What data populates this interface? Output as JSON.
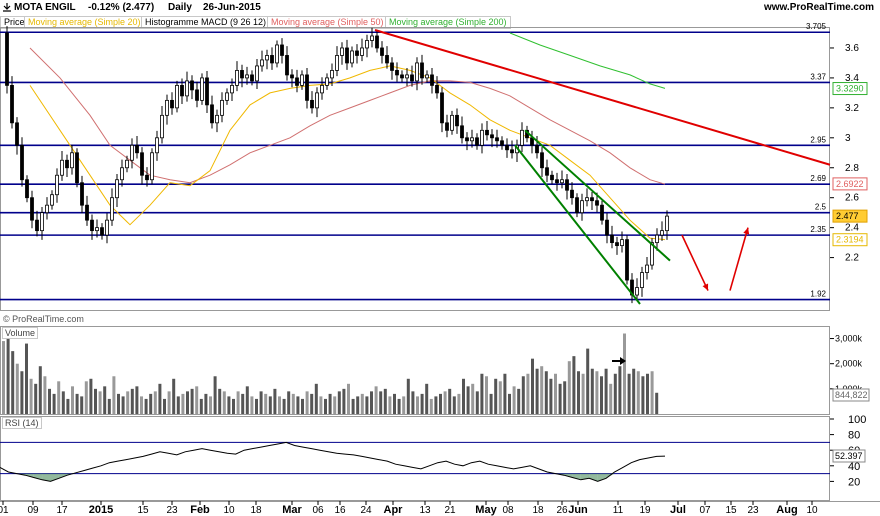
{
  "header": {
    "symbol": "MOTA ENGIL",
    "change_text": "-0.12% (2.477)",
    "period": "Daily",
    "date": "26-Jun-2015",
    "site": "www.ProRealTime.com"
  },
  "indicator_tabs": [
    {
      "label": "Price",
      "color": "#000000"
    },
    {
      "label": "Moving average (Simple 20)",
      "color": "#e6b800"
    },
    {
      "label": "Histogramme MACD (9 26 12)",
      "color": "#000000"
    },
    {
      "label": "Moving average (Simple 50)",
      "color": "#e06060"
    },
    {
      "label": "Moving average (Simple 200)",
      "color": "#30b030"
    }
  ],
  "watermark": "© ProRealTime.com",
  "volume_panel": {
    "label": "Volume"
  },
  "rsi_panel": {
    "label": "RSI (14)"
  },
  "colors": {
    "hline": "#00008b",
    "resistance": "#e00000",
    "channel": "#008000",
    "sma20": "#f0b800",
    "sma50": "#d07070",
    "sma200": "#30c030",
    "arrow": "#e00000",
    "candle": "#000000",
    "rsi": "#000000",
    "rsi_fill": "#4a8a5a",
    "volume_bar": "#555555"
  },
  "chart_data": [
    {
      "type": "candlestick",
      "title": "MOTA ENGIL Daily",
      "x_ticks": [
        "01",
        "09",
        "17",
        "2015",
        "15",
        "23",
        "Feb",
        "10",
        "18",
        "Mar",
        "06",
        "16",
        "24",
        "Apr",
        "13",
        "21",
        "May",
        "08",
        "18",
        "26",
        "Jun",
        "11",
        "19",
        "Jul",
        "07",
        "15",
        "23",
        "Aug",
        "10"
      ],
      "y_ticks": [
        2.2,
        2.4,
        2.6,
        2.8,
        3,
        3.2,
        3.4,
        3.6
      ],
      "ylim": [
        1.85,
        3.74
      ],
      "horizontal_levels": [
        {
          "label": "3.705",
          "value": 3.705
        },
        {
          "label": "3.37",
          "value": 3.37
        },
        {
          "label": "2.95",
          "value": 2.95
        },
        {
          "label": "2.69",
          "value": 2.69
        },
        {
          "label": "2.5",
          "value": 2.5
        },
        {
          "label": "2.35",
          "value": 2.35
        },
        {
          "label": "1.92",
          "value": 1.92
        }
      ],
      "right_markers": [
        {
          "label": "3.3290",
          "value": 3.329,
          "color": "#30b030"
        },
        {
          "label": "2.6922",
          "value": 2.6922,
          "color": "#e06060"
        },
        {
          "label": "2.477",
          "value": 2.477,
          "color": "#e0a000"
        },
        {
          "label": "2.3194",
          "value": 2.3194,
          "color": "#e6b800"
        }
      ],
      "close_path": [
        [
          0,
          3.7
        ],
        [
          5,
          3.35
        ],
        [
          10,
          3.1
        ],
        [
          15,
          2.95
        ],
        [
          20,
          2.72
        ],
        [
          25,
          2.6
        ],
        [
          30,
          2.45
        ],
        [
          35,
          2.38
        ],
        [
          40,
          2.5
        ],
        [
          45,
          2.55
        ],
        [
          50,
          2.62
        ],
        [
          55,
          2.75
        ],
        [
          60,
          2.85
        ],
        [
          65,
          2.8
        ],
        [
          70,
          2.9
        ],
        [
          75,
          2.7
        ],
        [
          80,
          2.55
        ],
        [
          85,
          2.45
        ],
        [
          90,
          2.38
        ],
        [
          95,
          2.4
        ],
        [
          100,
          2.35
        ],
        [
          105,
          2.45
        ],
        [
          110,
          2.6
        ],
        [
          115,
          2.72
        ],
        [
          120,
          2.8
        ],
        [
          125,
          2.85
        ],
        [
          130,
          2.95
        ],
        [
          135,
          2.9
        ],
        [
          140,
          2.75
        ],
        [
          145,
          2.72
        ],
        [
          150,
          2.9
        ],
        [
          155,
          3.0
        ],
        [
          160,
          3.15
        ],
        [
          165,
          3.25
        ],
        [
          170,
          3.2
        ],
        [
          175,
          3.35
        ],
        [
          180,
          3.28
        ],
        [
          185,
          3.38
        ],
        [
          190,
          3.32
        ],
        [
          195,
          3.25
        ],
        [
          200,
          3.4
        ],
        [
          205,
          3.22
        ],
        [
          210,
          3.1
        ],
        [
          215,
          3.15
        ],
        [
          220,
          3.25
        ],
        [
          225,
          3.3
        ],
        [
          230,
          3.35
        ],
        [
          235,
          3.45
        ],
        [
          240,
          3.4
        ],
        [
          245,
          3.42
        ],
        [
          250,
          3.38
        ],
        [
          255,
          3.48
        ],
        [
          260,
          3.52
        ],
        [
          265,
          3.55
        ],
        [
          270,
          3.5
        ],
        [
          275,
          3.62
        ],
        [
          280,
          3.55
        ],
        [
          285,
          3.42
        ],
        [
          290,
          3.4
        ],
        [
          295,
          3.35
        ],
        [
          300,
          3.42
        ],
        [
          305,
          3.25
        ],
        [
          310,
          3.2
        ],
        [
          315,
          3.3
        ],
        [
          320,
          3.35
        ],
        [
          325,
          3.4
        ],
        [
          330,
          3.45
        ],
        [
          335,
          3.55
        ],
        [
          340,
          3.6
        ],
        [
          345,
          3.5
        ],
        [
          350,
          3.58
        ],
        [
          355,
          3.55
        ],
        [
          360,
          3.6
        ],
        [
          365,
          3.65
        ],
        [
          370,
          3.68
        ],
        [
          375,
          3.6
        ],
        [
          380,
          3.55
        ],
        [
          385,
          3.5
        ],
        [
          390,
          3.45
        ],
        [
          395,
          3.42
        ],
        [
          400,
          3.4
        ],
        [
          405,
          3.42
        ],
        [
          410,
          3.38
        ],
        [
          415,
          3.5
        ],
        [
          420,
          3.4
        ],
        [
          425,
          3.42
        ],
        [
          430,
          3.35
        ],
        [
          435,
          3.3
        ],
        [
          440,
          3.1
        ],
        [
          445,
          3.05
        ],
        [
          450,
          3.15
        ],
        [
          455,
          3.08
        ],
        [
          460,
          3.0
        ],
        [
          465,
          2.98
        ],
        [
          470,
          3.0
        ],
        [
          475,
          2.95
        ],
        [
          480,
          3.05
        ],
        [
          485,
          3.02
        ],
        [
          490,
          3.0
        ],
        [
          495,
          2.98
        ],
        [
          500,
          2.95
        ],
        [
          505,
          2.92
        ],
        [
          510,
          2.9
        ],
        [
          515,
          2.95
        ],
        [
          520,
          3.05
        ],
        [
          525,
          3.0
        ],
        [
          530,
          2.95
        ],
        [
          535,
          2.9
        ],
        [
          540,
          2.8
        ],
        [
          545,
          2.75
        ],
        [
          550,
          2.72
        ],
        [
          555,
          2.7
        ],
        [
          560,
          2.72
        ],
        [
          565,
          2.65
        ],
        [
          570,
          2.6
        ],
        [
          575,
          2.5
        ],
        [
          580,
          2.58
        ],
        [
          585,
          2.6
        ],
        [
          590,
          2.58
        ],
        [
          595,
          2.55
        ],
        [
          600,
          2.45
        ],
        [
          605,
          2.35
        ],
        [
          610,
          2.3
        ],
        [
          615,
          2.28
        ],
        [
          620,
          2.32
        ],
        [
          625,
          2.05
        ],
        [
          630,
          1.95
        ],
        [
          635,
          2.0
        ],
        [
          640,
          2.1
        ],
        [
          645,
          2.15
        ],
        [
          650,
          2.3
        ],
        [
          655,
          2.35
        ],
        [
          660,
          2.38
        ],
        [
          665,
          2.477
        ]
      ],
      "sma20": [
        [
          30,
          3.35
        ],
        [
          60,
          3.05
        ],
        [
          90,
          2.75
        ],
        [
          110,
          2.55
        ],
        [
          130,
          2.42
        ],
        [
          150,
          2.55
        ],
        [
          170,
          2.7
        ],
        [
          190,
          2.68
        ],
        [
          210,
          2.78
        ],
        [
          230,
          3.05
        ],
        [
          250,
          3.22
        ],
        [
          270,
          3.3
        ],
        [
          290,
          3.33
        ],
        [
          310,
          3.35
        ],
        [
          330,
          3.36
        ],
        [
          350,
          3.4
        ],
        [
          370,
          3.45
        ],
        [
          390,
          3.48
        ],
        [
          410,
          3.45
        ],
        [
          430,
          3.4
        ],
        [
          450,
          3.3
        ],
        [
          470,
          3.22
        ],
        [
          490,
          3.12
        ],
        [
          510,
          3.05
        ],
        [
          530,
          3.0
        ],
        [
          550,
          2.95
        ],
        [
          570,
          2.85
        ],
        [
          590,
          2.75
        ],
        [
          610,
          2.6
        ],
        [
          630,
          2.45
        ],
        [
          650,
          2.33
        ],
        [
          665,
          2.32
        ]
      ],
      "sma50": [
        [
          30,
          3.6
        ],
        [
          60,
          3.4
        ],
        [
          90,
          3.15
        ],
        [
          110,
          2.95
        ],
        [
          130,
          2.85
        ],
        [
          150,
          2.75
        ],
        [
          170,
          2.72
        ],
        [
          190,
          2.7
        ],
        [
          210,
          2.75
        ],
        [
          230,
          2.82
        ],
        [
          250,
          2.9
        ],
        [
          270,
          2.95
        ],
        [
          290,
          3.0
        ],
        [
          310,
          3.08
        ],
        [
          330,
          3.15
        ],
        [
          350,
          3.2
        ],
        [
          370,
          3.25
        ],
        [
          390,
          3.3
        ],
        [
          410,
          3.35
        ],
        [
          430,
          3.38
        ],
        [
          450,
          3.38
        ],
        [
          470,
          3.37
        ],
        [
          490,
          3.33
        ],
        [
          510,
          3.28
        ],
        [
          530,
          3.2
        ],
        [
          550,
          3.12
        ],
        [
          570,
          3.05
        ],
        [
          590,
          2.98
        ],
        [
          610,
          2.9
        ],
        [
          630,
          2.8
        ],
        [
          650,
          2.72
        ],
        [
          665,
          2.69
        ]
      ],
      "sma200": [
        [
          510,
          3.7
        ],
        [
          540,
          3.62
        ],
        [
          570,
          3.55
        ],
        [
          600,
          3.48
        ],
        [
          630,
          3.42
        ],
        [
          650,
          3.36
        ],
        [
          665,
          3.33
        ]
      ],
      "resistance_line": [
        [
          375,
          3.72
        ],
        [
          830,
          2.82
        ]
      ],
      "channel_lines": [
        [
          [
            525,
            3.05
          ],
          [
            670,
            2.18
          ]
        ],
        [
          [
            515,
            2.95
          ],
          [
            640,
            1.89
          ]
        ]
      ],
      "forecast_arrows": [
        [
          [
            682,
            2.35
          ],
          [
            708,
            1.98
          ]
        ],
        [
          [
            730,
            1.98
          ],
          [
            748,
            2.4
          ]
        ]
      ]
    },
    {
      "type": "bar",
      "title": "Volume",
      "y_ticks": [
        "1,000k",
        "2,000k",
        "3,000k"
      ],
      "last_value": "844,822",
      "annotation": "arrow pointing to volume spike",
      "values_k": [
        2900,
        3000,
        2500,
        2000,
        1700,
        2800,
        1400,
        1200,
        1900,
        1500,
        1000,
        800,
        1300,
        900,
        600,
        1100,
        800,
        700,
        1300,
        1400,
        1000,
        900,
        1100,
        600,
        1500,
        800,
        700,
        900,
        1000,
        1100,
        700,
        600,
        800,
        900,
        1200,
        600,
        900,
        1400,
        700,
        800,
        900,
        1000,
        1100,
        600,
        800,
        700,
        1500,
        1000,
        900,
        700,
        600,
        900,
        800,
        1100,
        700,
        600,
        900,
        800,
        700,
        1000,
        700,
        600,
        900,
        800,
        700,
        600,
        900,
        800,
        1200,
        700,
        600,
        800,
        700,
        900,
        1000,
        1200,
        600,
        700,
        800,
        700,
        900,
        1100,
        900,
        1000,
        700,
        800,
        600,
        700,
        1400,
        900,
        700,
        800,
        1200,
        600,
        700,
        800,
        900,
        1000,
        700,
        800,
        1400,
        1100,
        1200,
        900,
        1600,
        1500,
        800,
        1400,
        1300,
        1600,
        800,
        1100,
        1000,
        1500,
        1600,
        2200,
        1800,
        1900,
        1700,
        1400,
        1600,
        1200,
        1300,
        2100,
        2300,
        1700,
        1600,
        2600,
        1800,
        1700,
        1500,
        1800,
        1200,
        1600,
        1900,
        3200,
        1600,
        1800,
        1700,
        1500,
        1600,
        1700,
        844
      ]
    },
    {
      "type": "line",
      "title": "RSI (14)",
      "y_ticks": [
        20,
        40,
        60,
        80,
        100
      ],
      "ylim": [
        0,
        100
      ],
      "bands": [
        30,
        70
      ],
      "last_value": "52.397",
      "values": [
        38,
        32,
        30,
        28,
        25,
        22,
        20,
        24,
        28,
        31,
        34,
        37,
        40,
        44,
        46,
        48,
        50,
        52,
        55,
        58,
        56,
        54,
        58,
        60,
        62,
        60,
        58,
        56,
        55,
        60,
        62,
        64,
        66,
        68,
        70,
        66,
        64,
        62,
        60,
        58,
        56,
        55,
        54,
        52,
        50,
        48,
        46,
        42,
        40,
        38,
        36,
        40,
        44,
        46,
        42,
        40,
        44,
        46,
        42,
        40,
        38,
        36,
        38,
        40,
        36,
        32,
        30,
        28,
        25,
        22,
        24,
        20,
        24,
        32,
        38,
        44,
        48,
        50,
        52,
        52.397
      ]
    }
  ]
}
